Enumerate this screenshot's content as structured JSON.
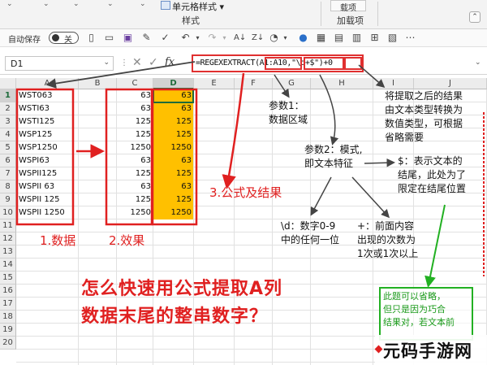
{
  "ribbon": {
    "cell_style_label": "单元格样式",
    "style_group_label": "样式",
    "addin_button_label": "载项",
    "addin_group_label": "加载项"
  },
  "qat": {
    "autosave_label": "自动保存",
    "autosave_state": "关",
    "icons": [
      "new-file-icon",
      "open-folder-icon",
      "save-icon",
      "edit-icon",
      "check-icon",
      "undo-icon",
      "redo-icon",
      "sort-asc-icon",
      "sort-desc-icon",
      "shapes-icon",
      "color-icon",
      "image-icon",
      "table-icon",
      "chart-icon",
      "grid-icon",
      "format-icon",
      "more-icon"
    ]
  },
  "formula_bar": {
    "name_box": "D1",
    "formula": "=REGEXEXTRACT(A1:A10,\"\\d+$\")+0"
  },
  "grid": {
    "columns": [
      "A",
      "B",
      "C",
      "D",
      "E",
      "F",
      "G",
      "H",
      "I",
      "J"
    ],
    "rows": [
      "1",
      "2",
      "3",
      "4",
      "5",
      "6",
      "7",
      "8",
      "9",
      "10",
      "11",
      "12",
      "13",
      "14",
      "15",
      "16",
      "17",
      "18",
      "19",
      "20"
    ],
    "data": [
      "WST063",
      "WSTI63",
      "WSTI125",
      "WSP125",
      "WSP1250",
      "WSPI63",
      "WSPII125",
      "WSPII 63",
      "WSPII 125",
      "WSPII 1250"
    ],
    "effect": [
      "63",
      "63",
      "125",
      "125",
      "1250",
      "63",
      "125",
      "63",
      "125",
      "1250"
    ],
    "result": [
      "63",
      "63",
      "125",
      "125",
      "1250",
      "63",
      "125",
      "63",
      "125",
      "1250"
    ]
  },
  "annotations": {
    "param1": [
      "参数1：",
      "数据区域"
    ],
    "param2": [
      "参数2：模式,",
      "即文本特征"
    ],
    "right_top": [
      "将提取之后的结果",
      "由文本类型转换为",
      "数值类型，可根据",
      "省略需要"
    ],
    "dollar": [
      "$：表示文本的",
      "结尾，此处为了",
      "限定在结尾位置"
    ],
    "digit": [
      "\\d：数字0-9",
      "中的任何一位"
    ],
    "plus": [
      "+：前面内容",
      "出现的次数为",
      "1次或1次以上"
    ],
    "label_data": "1.数据",
    "label_effect": "2.效果",
    "label_formula": "3.公式及结果",
    "title_line1": "怎么快速用公式提取A列",
    "title_line2": "数据末尾的整串数字？",
    "green_note": [
      "此题可以省略，",
      "但只是因为巧合",
      "结果对，若文本前"
    ],
    "watermark": "元码手游网"
  },
  "colors": {
    "accent_red": "#e02020",
    "accent_green": "#22b022",
    "result_fill": "#ffc000",
    "excel_green": "#217346"
  }
}
